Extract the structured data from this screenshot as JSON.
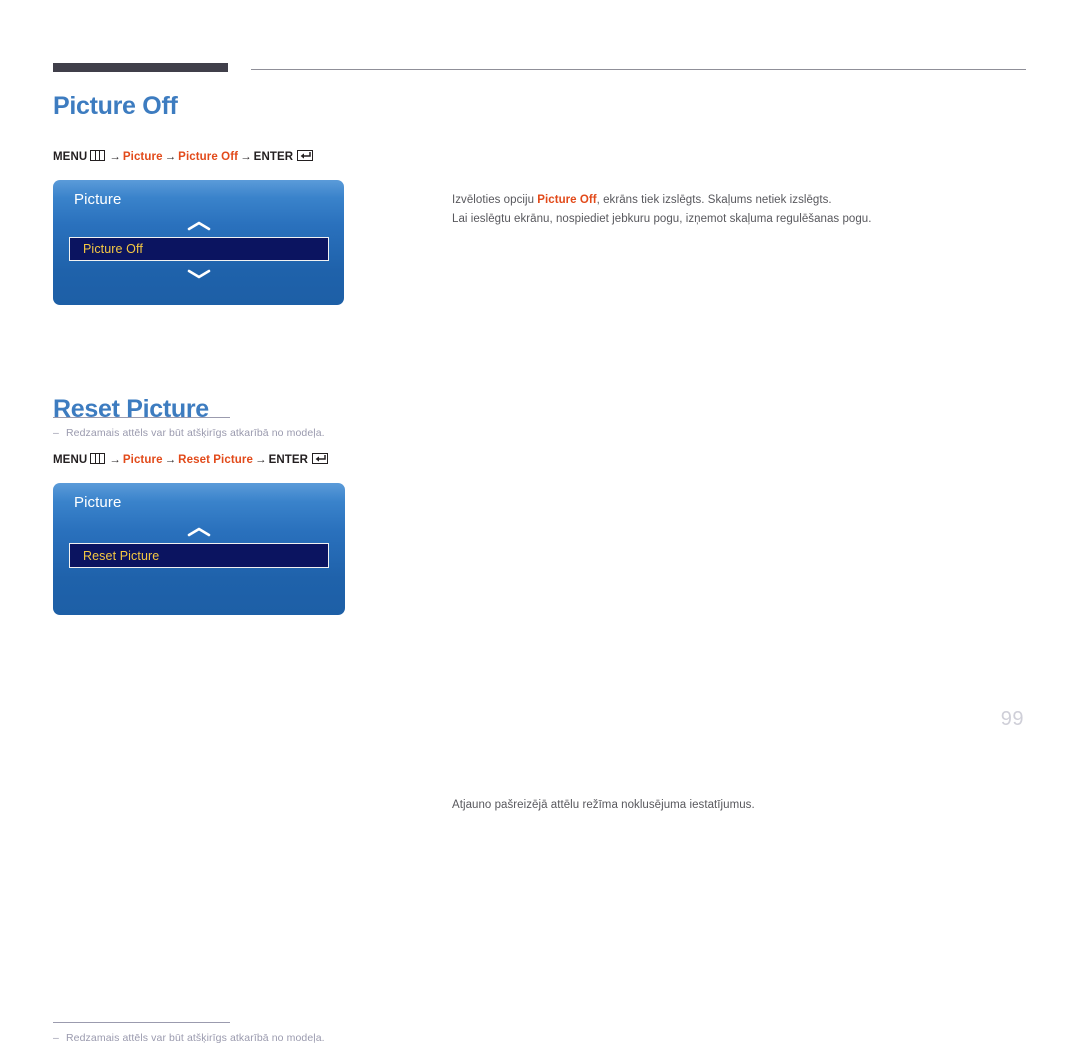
{
  "page": {
    "number": "99",
    "language": "lv"
  },
  "colors": {
    "heading_blue": "#3d7cc0",
    "accent_orange": "#e24a1a",
    "osd_blue_top": "#5b9bd9",
    "osd_blue_bottom": "#1d5fa6",
    "osd_item_bg": "#0b1460",
    "osd_item_text": "#f5c842",
    "header_bar": "#403f4a",
    "footnote_gray": "#9a9aae",
    "body_text": "#58585d",
    "page_number": "#cfcfd8"
  },
  "sections": [
    {
      "id": "picture-off",
      "heading": "Picture Off",
      "menu_path": {
        "menu_label": "MENU",
        "menu_icon": "menu-icon",
        "arrow": "→",
        "step1": "Picture",
        "step2": "Picture Off",
        "enter_label": "ENTER",
        "enter_icon": "enter-icon"
      },
      "osd": {
        "title": "Picture",
        "chevron_up": "chevron-up-icon",
        "chevron_down": "chevron-down-icon",
        "has_chevron_down": true,
        "selected_item": "Picture Off"
      },
      "footnote": {
        "dash": "–",
        "text": "Redzamais attēls var būt atšķirīgs atkarībā no modeļa."
      },
      "description": {
        "line1_before": "Izvēloties opciju ",
        "line1_bold": "Picture Off",
        "line1_after": ", ekrāns tiek izslēgts. Skaļums netiek izslēgts.",
        "line2": "Lai ieslēgtu ekrānu, nospiediet jebkuru pogu, izņemot skaļuma regulēšanas pogu."
      }
    },
    {
      "id": "reset-picture",
      "heading": "Reset Picture",
      "menu_path": {
        "menu_label": "MENU",
        "menu_icon": "menu-icon",
        "arrow": "→",
        "step1": "Picture",
        "step2": "Reset Picture",
        "enter_label": "ENTER",
        "enter_icon": "enter-icon"
      },
      "osd": {
        "title": "Picture",
        "chevron_up": "chevron-up-icon",
        "chevron_down": "",
        "has_chevron_down": false,
        "selected_item": "Reset Picture"
      },
      "footnote": {
        "dash": "–",
        "text": "Redzamais attēls var būt atšķirīgs atkarībā no modeļa."
      },
      "description": {
        "line1_before": "",
        "line1_bold": "",
        "line1_after": "Atjauno pašreizējā attēlu režīma noklusējuma iestatījumus.",
        "line2": ""
      }
    }
  ]
}
